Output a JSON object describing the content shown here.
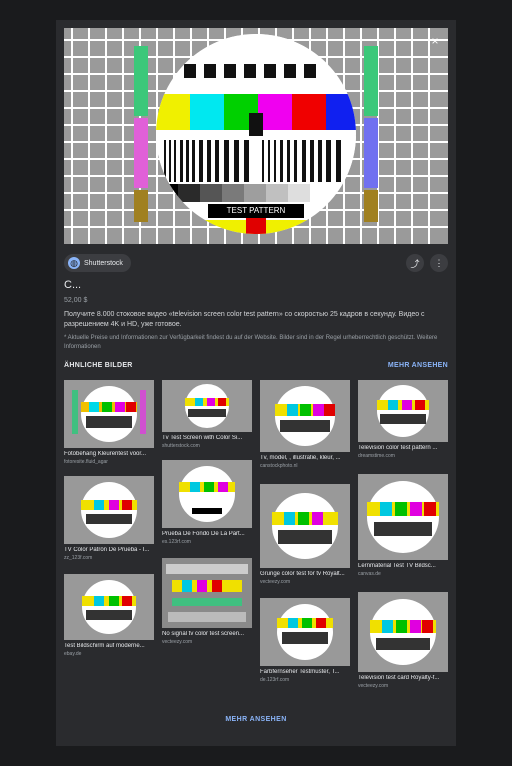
{
  "close_label": "×",
  "source": {
    "name": "Shutterstock",
    "icon": "globe-icon"
  },
  "title": "C...",
  "size": "52,00 $",
  "description": "Получите 8.000 стоковое видео «television screen color test pattern» со скоростью 25 кадров в секунду. Видео с разрешением 4K и HD, уже готовое.",
  "note": "* Aktuelle Preise und Informationen zur Verfügbarkeit findest du auf der Website. Bilder sind in der Regel urheberrechtlich geschützt. Weitere Informationen",
  "hero_caption": "TEST PATTERN",
  "similar": {
    "heading": "ÄHNLICHE BILDER",
    "more": "MEHR ANSEHEN",
    "items": [
      {
        "caption": "Fotobehang Kleurentest voor...",
        "source": "fotoresite.fluid_agar"
      },
      {
        "caption": "TV Color Patrón De Prueba - I...",
        "source": "zz_123f.com"
      },
      {
        "caption": "Test Bildschirm auf moderne...",
        "source": "ebay.de"
      },
      {
        "caption": "Tv Test Screen with Color Si...",
        "source": "shutterstock.com"
      },
      {
        "caption": "Prueba De Fondo De La Part...",
        "source": "es.123rf.com"
      },
      {
        "caption": "No signal tv color test screen...",
        "source": "vecteezy.com"
      },
      {
        "caption": "Tv, model, , illustratie, kleur, ...",
        "source": "canstockphoto.nl"
      },
      {
        "caption": "Grunge color test for tv Royalt...",
        "source": "vecteezy.com"
      },
      {
        "caption": "Farbfernseher Testmuster, T...",
        "source": "de.123rf.com"
      },
      {
        "caption": "Television color test pattern ...",
        "source": "dreamstime.com"
      },
      {
        "caption": "Lernmaterial Test TV Bildsc...",
        "source": "canvas.de"
      },
      {
        "caption": "Television test card Royalty-f...",
        "source": "vecteezy.com"
      }
    ]
  },
  "more_bottom": "MEHR ANSEHEN"
}
